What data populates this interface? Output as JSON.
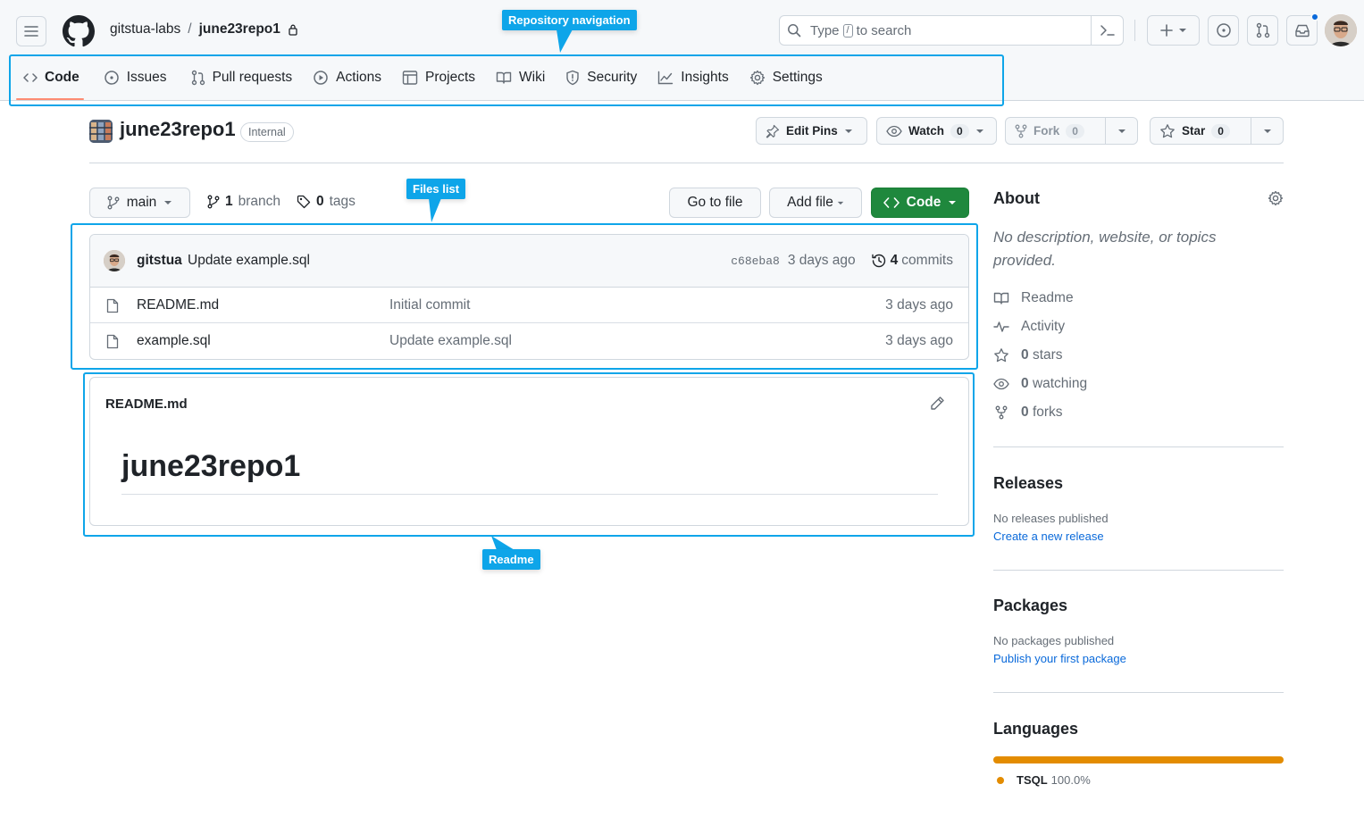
{
  "header": {
    "org": "gitstua-labs",
    "separator": "/",
    "repo": "june23repo1",
    "search_prefix": "Type",
    "search_key": "/",
    "search_suffix": "to search"
  },
  "tabs": [
    {
      "label": "Code",
      "icon": "code-icon",
      "active": true
    },
    {
      "label": "Issues",
      "icon": "issue-icon"
    },
    {
      "label": "Pull requests",
      "icon": "pull-request-icon"
    },
    {
      "label": "Actions",
      "icon": "play-icon"
    },
    {
      "label": "Projects",
      "icon": "table-icon"
    },
    {
      "label": "Wiki",
      "icon": "book-icon"
    },
    {
      "label": "Security",
      "icon": "shield-icon"
    },
    {
      "label": "Insights",
      "icon": "graph-icon"
    },
    {
      "label": "Settings",
      "icon": "gear-icon"
    }
  ],
  "repo_header": {
    "title": "june23repo1",
    "visibility": "Internal",
    "edit_pins": "Edit Pins",
    "watch": "Watch",
    "watch_count": "0",
    "fork": "Fork",
    "fork_count": "0",
    "star": "Star",
    "star_count": "0"
  },
  "toolbar": {
    "branch": "main",
    "branch_count": "1",
    "branch_label": "branch",
    "tag_count": "0",
    "tag_label": "tags",
    "go_to_file": "Go to file",
    "add_file": "Add file",
    "code": "Code"
  },
  "latest_commit": {
    "user": "gitstua",
    "message": "Update example.sql",
    "sha": "c68eba8",
    "age": "3 days ago",
    "commit_count": "4",
    "commit_label": "commits"
  },
  "files": [
    {
      "name": "README.md",
      "message": "Initial commit",
      "age": "3 days ago"
    },
    {
      "name": "example.sql",
      "message": "Update example.sql",
      "age": "3 days ago"
    }
  ],
  "readme": {
    "filename": "README.md",
    "heading": "june23repo1"
  },
  "sidebar": {
    "about_title": "About",
    "about_desc": "No description, website, or topics provided.",
    "readme": "Readme",
    "activity": "Activity",
    "stars_count": "0",
    "stars_label": "stars",
    "watching_count": "0",
    "watching_label": "watching",
    "forks_count": "0",
    "forks_label": "forks",
    "releases_title": "Releases",
    "releases_none": "No releases published",
    "releases_link": "Create a new release",
    "packages_title": "Packages",
    "packages_none": "No packages published",
    "packages_link": "Publish your first package",
    "languages_title": "Languages",
    "language_name": "TSQL",
    "language_pct": "100.0%"
  },
  "annotations": {
    "repo_nav": "Repository navigation",
    "files_list": "Files list",
    "readme": "Readme"
  },
  "colors": {
    "accent_blue": "#0969da",
    "callout": "#0ea5e9",
    "green_button": "#1f883d",
    "tab_underline": "#fd8c73",
    "tsql": "#e38c00"
  }
}
